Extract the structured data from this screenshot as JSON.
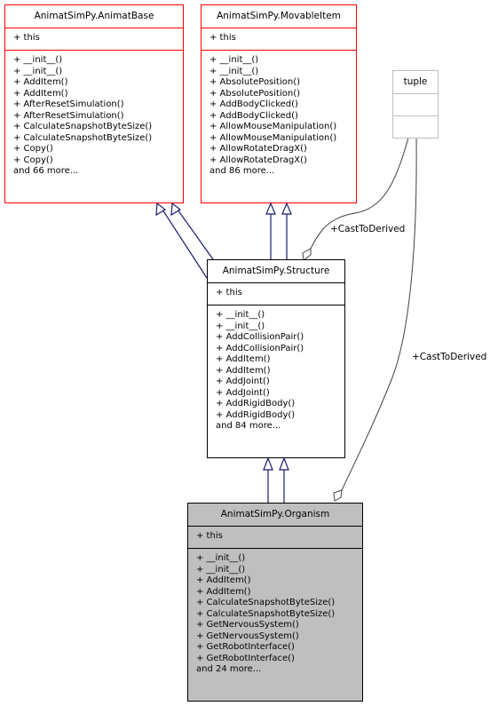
{
  "diagram": {
    "type": "class-inheritance-collaboration",
    "classes": {
      "animat_base": {
        "name": "AnimatSimPy.AnimatBase",
        "attributes": [
          "+ this"
        ],
        "methods": [
          "+ __init__()",
          "+ __init__()",
          "+ AddItem()",
          "+ AddItem()",
          "+ AfterResetSimulation()",
          "+ AfterResetSimulation()",
          "+ CalculateSnapshotByteSize()",
          "+ CalculateSnapshotByteSize()",
          "+ Copy()",
          "+ Copy()",
          "and 66 more..."
        ]
      },
      "movable_item": {
        "name": "AnimatSimPy.MovableItem",
        "attributes": [
          "+ this"
        ],
        "methods": [
          "+ __init__()",
          "+ __init__()",
          "+ AbsolutePosition()",
          "+ AbsolutePosition()",
          "+ AddBodyClicked()",
          "+ AddBodyClicked()",
          "+ AllowMouseManipulation()",
          "+ AllowMouseManipulation()",
          "+ AllowRotateDragX()",
          "+ AllowRotateDragX()",
          "and 86 more..."
        ]
      },
      "tuple": {
        "name": "tuple",
        "attributes": [],
        "methods": []
      },
      "structure": {
        "name": "AnimatSimPy.Structure",
        "attributes": [
          "+ this"
        ],
        "methods": [
          "+ __init__()",
          "+ __init__()",
          "+ AddCollisionPair()",
          "+ AddCollisionPair()",
          "+ AddItem()",
          "+ AddItem()",
          "+ AddJoint()",
          "+ AddJoint()",
          "+ AddRigidBody()",
          "+ AddRigidBody()",
          "and 84 more..."
        ]
      },
      "organism": {
        "name": "AnimatSimPy.Organism",
        "attributes": [
          "+ this"
        ],
        "methods": [
          "+ __init__()",
          "+ __init__()",
          "+ AddItem()",
          "+ AddItem()",
          "+ CalculateSnapshotByteSize()",
          "+ CalculateSnapshotByteSize()",
          "+ GetNervousSystem()",
          "+ GetNervousSystem()",
          "+ GetRobotInterface()",
          "+ GetRobotInterface()",
          "and 24 more..."
        ]
      }
    },
    "edges": [
      {
        "from": "structure",
        "to": "animat_base",
        "kind": "inheritance",
        "count": 2
      },
      {
        "from": "structure",
        "to": "movable_item",
        "kind": "inheritance",
        "count": 2
      },
      {
        "from": "organism",
        "to": "structure",
        "kind": "inheritance",
        "count": 2
      },
      {
        "from": "tuple",
        "to": "structure",
        "kind": "usage",
        "label": "+CastToDerived"
      },
      {
        "from": "tuple",
        "to": "organism",
        "kind": "usage",
        "label": "+CastToDerived"
      }
    ],
    "edge_labels": {
      "structure_cast": "+CastToDerived",
      "organism_cast": "+CastToDerived"
    },
    "colors": {
      "inherited_border": "#ff0000",
      "class_border": "#000000",
      "focus_fill": "#bfbfbf",
      "external_border": "#bfbfbf",
      "inheritance_edge": "#191970",
      "usage_edge": "#404040"
    }
  }
}
